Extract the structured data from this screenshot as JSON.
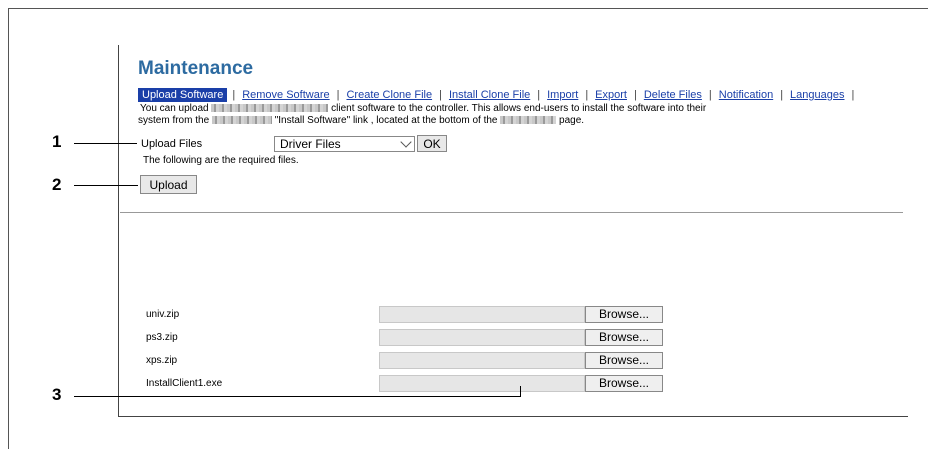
{
  "page": {
    "title": "Maintenance",
    "tabs": [
      {
        "label": "Upload Software",
        "active": true
      },
      {
        "label": "Remove Software",
        "active": false
      },
      {
        "label": "Create Clone File",
        "active": false
      },
      {
        "label": "Install Clone File",
        "active": false
      },
      {
        "label": "Import",
        "active": false
      },
      {
        "label": "Export",
        "active": false
      },
      {
        "label": "Delete Files",
        "active": false
      },
      {
        "label": "Notification",
        "active": false
      },
      {
        "label": "Languages",
        "active": false
      }
    ],
    "description": {
      "line1_a": "You can upload",
      "line1_b": "client software to the controller. This allows end-users to install the software into their",
      "line2_a": "system from the",
      "line2_b": "\"Install Software\" link , located at the bottom of the",
      "line2_c": "page."
    },
    "upload_files": {
      "label": "Upload Files",
      "selected": "Driver Files",
      "ok_label": "OK"
    },
    "required_text": "The following are the required files.",
    "upload_button": "Upload",
    "files": [
      {
        "name": "univ.zip",
        "browse": "Browse..."
      },
      {
        "name": "ps3.zip",
        "browse": "Browse..."
      },
      {
        "name": "xps.zip",
        "browse": "Browse..."
      },
      {
        "name": "InstallClient1.exe",
        "browse": "Browse..."
      }
    ]
  },
  "callouts": [
    "1",
    "2",
    "3"
  ],
  "colors": {
    "title": "#2d6ba1",
    "link": "#1a3fa8",
    "active_tab_bg": "#1a3fa8"
  }
}
